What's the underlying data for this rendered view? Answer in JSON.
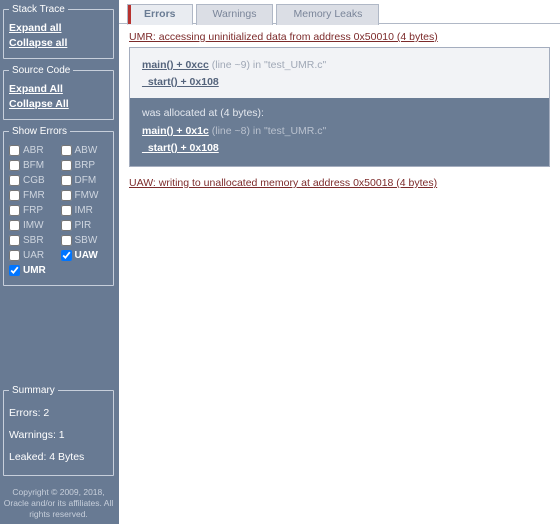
{
  "sidebar": {
    "stackTrace": {
      "legend": "Stack Trace",
      "expand": "Expand all",
      "collapse": "Collapse all"
    },
    "sourceCode": {
      "legend": "Source Code",
      "expand": "Expand All",
      "collapse": "Collapse All"
    },
    "filters": {
      "legend": "Show Errors",
      "items": [
        {
          "code": "ABR",
          "checked": false
        },
        {
          "code": "ABW",
          "checked": false
        },
        {
          "code": "BFM",
          "checked": false
        },
        {
          "code": "BRP",
          "checked": false
        },
        {
          "code": "CGB",
          "checked": false
        },
        {
          "code": "DFM",
          "checked": false
        },
        {
          "code": "FMR",
          "checked": false
        },
        {
          "code": "FMW",
          "checked": false
        },
        {
          "code": "FRP",
          "checked": false
        },
        {
          "code": "IMR",
          "checked": false
        },
        {
          "code": "IMW",
          "checked": false
        },
        {
          "code": "PIR",
          "checked": false
        },
        {
          "code": "SBR",
          "checked": false
        },
        {
          "code": "SBW",
          "checked": false
        },
        {
          "code": "UAR",
          "checked": false
        },
        {
          "code": "UAW",
          "checked": true
        },
        {
          "code": "UMR",
          "checked": true
        }
      ]
    },
    "summary": {
      "legend": "Summary",
      "errors": "Errors: 2",
      "warnings": "Warnings: 1",
      "leaked": "Leaked: 4 Bytes"
    },
    "copyright": "Copyright © 2009, 2018, Oracle and/or its affiliates. All rights reserved."
  },
  "tabs": {
    "errors": "Errors",
    "warnings": "Warnings",
    "leaks": "Memory Leaks"
  },
  "errors": {
    "umr": {
      "title": "UMR: accessing uninitialized data from address 0x50010 (4 bytes)",
      "f1": {
        "fn": "main() + 0xcc",
        "loc": " (line ~9) in \"test_UMR.c\""
      },
      "f2": {
        "fn": "_start() + 0x108"
      },
      "alloc": {
        "hdr": "was allocated at (4 bytes):",
        "f1": {
          "fn": "main() + 0x1c",
          "loc": " (line ~8) in \"test_UMR.c\""
        },
        "f2": {
          "fn": "_start() + 0x108"
        }
      }
    },
    "uaw": {
      "title": "UAW: writing to unallocated memory at address 0x50018 (4 bytes)"
    }
  }
}
